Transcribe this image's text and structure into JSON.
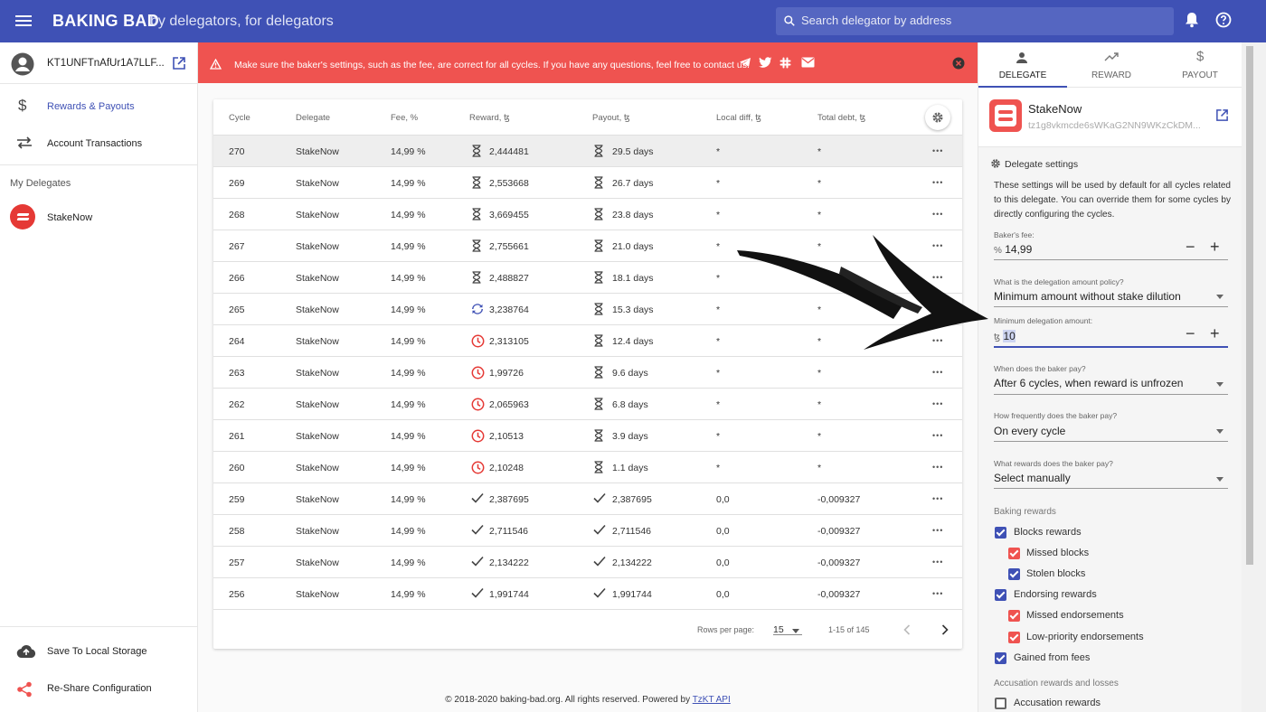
{
  "topbar": {
    "brand": "BAKING BAD",
    "tagline": "by delegators, for delegators",
    "search_placeholder": "Search delegator by address"
  },
  "sidebar": {
    "account_address": "KT1UNFTnAfUr1A7LLF...",
    "items": [
      {
        "label": "Rewards & Payouts",
        "icon": "dollar-icon",
        "active": true
      },
      {
        "label": "Account Transactions",
        "icon": "swap-icon",
        "active": false
      }
    ],
    "my_delegates_title": "My Delegates",
    "delegates": [
      {
        "name": "StakeNow"
      }
    ],
    "bottom_items": [
      {
        "label": "Save To Local Storage",
        "icon": "cloud-upload-icon"
      },
      {
        "label": "Re-Share Configuration",
        "icon": "share-icon"
      }
    ]
  },
  "alert": {
    "message": "Make sure the baker's settings, such as the fee, are correct for all cycles. If you have any questions, feel free to contact us:",
    "color": "#ef5350"
  },
  "table": {
    "headers": {
      "cycle": "Cycle",
      "delegate": "Delegate",
      "fee": "Fee, %",
      "reward": "Reward, ꜩ",
      "payout": "Payout, ꜩ",
      "local_diff": "Local diff, ꜩ",
      "total_debt": "Total debt, ꜩ"
    },
    "rows": [
      {
        "cycle": "270",
        "delegate": "StakeNow",
        "fee": "14,99 %",
        "reward_icon": "hourglass",
        "reward": "2,444481",
        "payout_icon": "hourglass",
        "payout": "29.5 days",
        "local_diff": "*",
        "total_debt": "*"
      },
      {
        "cycle": "269",
        "delegate": "StakeNow",
        "fee": "14,99 %",
        "reward_icon": "hourglass",
        "reward": "2,553668",
        "payout_icon": "hourglass",
        "payout": "26.7 days",
        "local_diff": "*",
        "total_debt": "*"
      },
      {
        "cycle": "268",
        "delegate": "StakeNow",
        "fee": "14,99 %",
        "reward_icon": "hourglass",
        "reward": "3,669455",
        "payout_icon": "hourglass",
        "payout": "23.8 days",
        "local_diff": "*",
        "total_debt": "*"
      },
      {
        "cycle": "267",
        "delegate": "StakeNow",
        "fee": "14,99 %",
        "reward_icon": "hourglass",
        "reward": "2,755661",
        "payout_icon": "hourglass",
        "payout": "21.0 days",
        "local_diff": "*",
        "total_debt": "*"
      },
      {
        "cycle": "266",
        "delegate": "StakeNow",
        "fee": "14,99 %",
        "reward_icon": "hourglass",
        "reward": "2,488827",
        "payout_icon": "hourglass",
        "payout": "18.1 days",
        "local_diff": "*",
        "total_debt": "*"
      },
      {
        "cycle": "265",
        "delegate": "StakeNow",
        "fee": "14,99 %",
        "reward_icon": "sync",
        "reward": "3,238764",
        "payout_icon": "hourglass",
        "payout": "15.3 days",
        "local_diff": "*",
        "total_debt": "*"
      },
      {
        "cycle": "264",
        "delegate": "StakeNow",
        "fee": "14,99 %",
        "reward_icon": "clock",
        "reward": "2,313105",
        "payout_icon": "hourglass",
        "payout": "12.4 days",
        "local_diff": "*",
        "total_debt": "*"
      },
      {
        "cycle": "263",
        "delegate": "StakeNow",
        "fee": "14,99 %",
        "reward_icon": "clock",
        "reward": "1,99726",
        "payout_icon": "hourglass",
        "payout": "9.6 days",
        "local_diff": "*",
        "total_debt": "*"
      },
      {
        "cycle": "262",
        "delegate": "StakeNow",
        "fee": "14,99 %",
        "reward_icon": "clock",
        "reward": "2,065963",
        "payout_icon": "hourglass",
        "payout": "6.8 days",
        "local_diff": "*",
        "total_debt": "*"
      },
      {
        "cycle": "261",
        "delegate": "StakeNow",
        "fee": "14,99 %",
        "reward_icon": "clock",
        "reward": "2,10513",
        "payout_icon": "hourglass",
        "payout": "3.9 days",
        "local_diff": "*",
        "total_debt": "*"
      },
      {
        "cycle": "260",
        "delegate": "StakeNow",
        "fee": "14,99 %",
        "reward_icon": "clock",
        "reward": "2,10248",
        "payout_icon": "hourglass",
        "payout": "1.1 days",
        "local_diff": "*",
        "total_debt": "*"
      },
      {
        "cycle": "259",
        "delegate": "StakeNow",
        "fee": "14,99 %",
        "reward_icon": "check",
        "reward": "2,387695",
        "payout_icon": "check",
        "payout": "2,387695",
        "local_diff": "0,0",
        "total_debt": "-0,009327"
      },
      {
        "cycle": "258",
        "delegate": "StakeNow",
        "fee": "14,99 %",
        "reward_icon": "check",
        "reward": "2,711546",
        "payout_icon": "check",
        "payout": "2,711546",
        "local_diff": "0,0",
        "total_debt": "-0,009327"
      },
      {
        "cycle": "257",
        "delegate": "StakeNow",
        "fee": "14,99 %",
        "reward_icon": "check",
        "reward": "2,134222",
        "payout_icon": "check",
        "payout": "2,134222",
        "local_diff": "0,0",
        "total_debt": "-0,009327"
      },
      {
        "cycle": "256",
        "delegate": "StakeNow",
        "fee": "14,99 %",
        "reward_icon": "check",
        "reward": "1,991744",
        "payout_icon": "check",
        "payout": "1,991744",
        "local_diff": "0,0",
        "total_debt": "-0,009327"
      }
    ],
    "footer": {
      "rows_per_page_label": "Rows per page:",
      "rows_per_page": "15",
      "range": "1-15 of 145"
    }
  },
  "footer": {
    "text": "© 2018-2020 baking-bad.org. All rights reserved. Powered by",
    "link": "TzKT API"
  },
  "right_panel": {
    "tabs": [
      {
        "label": "DELEGATE",
        "icon": "person-icon",
        "active": true
      },
      {
        "label": "REWARD",
        "icon": "trending-up-icon",
        "active": false
      },
      {
        "label": "PAYOUT",
        "icon": "dollar-icon",
        "active": false
      }
    ],
    "delegate": {
      "name": "StakeNow",
      "address": "tz1g8vkmcde6sWKaG2NN9WKzCkDM..."
    },
    "settings": {
      "title": "Delegate settings",
      "description": "These settings will be used by default for all cycles related to this delegate. You can override them for some cycles by directly configuring the cycles.",
      "fee_label": "Baker's fee:",
      "fee_prefix": "%",
      "fee_value": "14,99",
      "policy_label": "What is the delegation amount policy?",
      "policy_value": "Minimum amount without stake dilution",
      "min_amount_label": "Minimum delegation amount:",
      "min_amount_prefix": "ꜩ",
      "min_amount_value": "10",
      "when_label": "When does the baker pay?",
      "when_value": "After 6 cycles, when reward is unfrozen",
      "freq_label": "How frequently does the baker pay?",
      "freq_value": "On every cycle",
      "rewards_label": "What rewards does the baker pay?",
      "rewards_value": "Select manually",
      "baking_rewards_title": "Baking rewards",
      "checkboxes": [
        {
          "label": "Blocks rewards",
          "checked": true,
          "color": "#3f51b5"
        },
        {
          "label": "Missed blocks",
          "checked": true,
          "color": "#ef5350"
        },
        {
          "label": "Stolen blocks",
          "checked": true,
          "color": "#3f51b5"
        },
        {
          "label": "Endorsing rewards",
          "checked": true,
          "color": "#3f51b5"
        },
        {
          "label": "Missed endorsements",
          "checked": true,
          "color": "#ef5350"
        },
        {
          "label": "Low-priority endorsements",
          "checked": true,
          "color": "#ef5350"
        },
        {
          "label": "Gained from fees",
          "checked": true,
          "color": "#3f51b5"
        }
      ],
      "accusation_title": "Accusation rewards and losses",
      "accusation_checkbox": {
        "label": "Accusation rewards",
        "checked": false
      }
    }
  },
  "colors": {
    "primary": "#3f51b5",
    "danger": "#ef5350"
  }
}
